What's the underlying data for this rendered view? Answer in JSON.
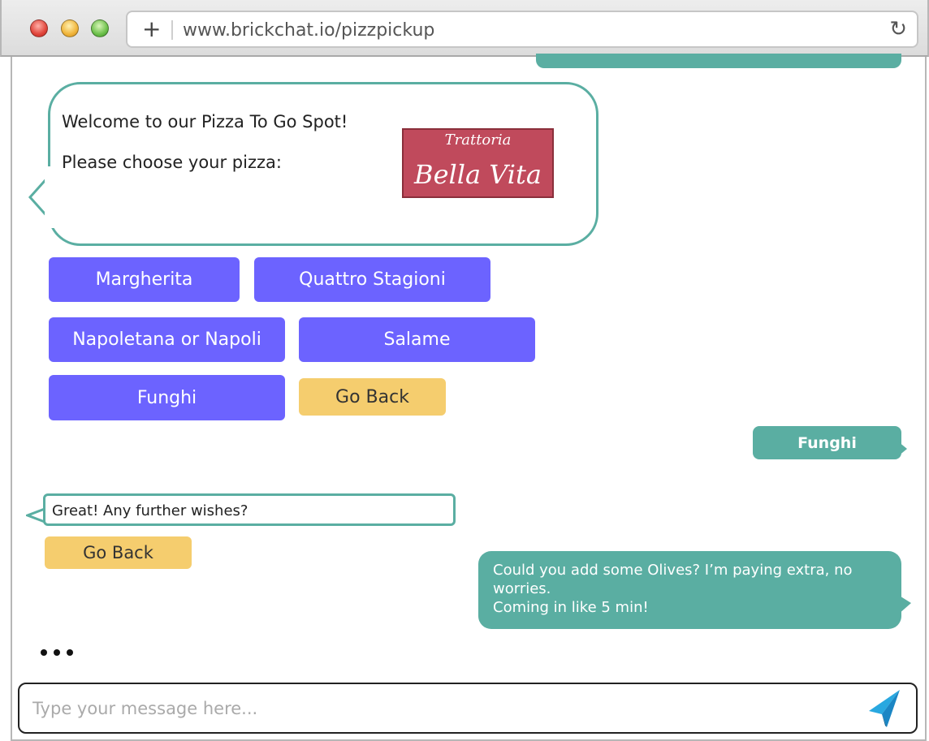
{
  "browser": {
    "url": "www.brickchat.io/pizzpickup",
    "new_tab_icon": "+",
    "reload_icon": "↻"
  },
  "bot_message_1": {
    "line1": "Welcome to our Pizza To Go Spot!",
    "line2": "Please choose your pizza:"
  },
  "logo": {
    "line1": "Trattoria",
    "line2": "Bella Vita"
  },
  "pizza_options": {
    "margherita": "Margherita",
    "quattro": "Quattro Stagioni",
    "napoletana": "Napoletana or Napoli",
    "salame": "Salame",
    "funghi": "Funghi",
    "go_back": "Go Back"
  },
  "user_message_1": "Funghi",
  "bot_message_2": "Great! Any further wishes?",
  "bot_message_2_button": "Go Back",
  "user_message_2": {
    "line1": "Could you add some Olives? I’m paying extra, no",
    "line2": "worries.",
    "line3": "Coming in like 5 min!"
  },
  "composer": {
    "placeholder": "Type your message here..."
  },
  "colors": {
    "teal": "#5aaea2",
    "purple": "#6c63ff",
    "yellow": "#f5cd6e",
    "send": "#1a9fd9"
  }
}
